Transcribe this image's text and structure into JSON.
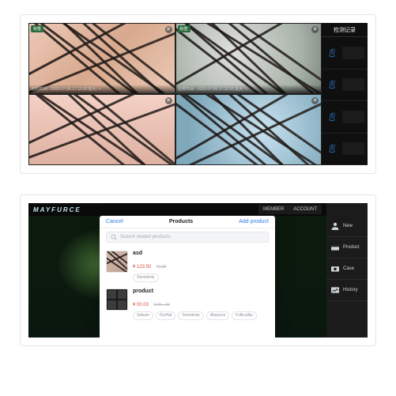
{
  "shot1": {
    "tiles": [
      {
        "badge": "标签",
        "meta": "拍照时间 : 2020-07-06 17:11:20 放大: ×"
      },
      {
        "badge": "标签",
        "meta": "拍照时间 : 2020-07-06 17:11:20 放大: ×"
      },
      {
        "badge": "",
        "meta": ""
      },
      {
        "badge": "",
        "meta": ""
      }
    ],
    "side_title": "检测记录"
  },
  "shot2": {
    "logo": "MAYFURCE",
    "top_tabs": [
      "MEMBER",
      "ACCOUNT"
    ],
    "nav": [
      {
        "label": "New"
      },
      {
        "label": "Product"
      },
      {
        "label": "Case"
      },
      {
        "label": "History"
      }
    ],
    "modal": {
      "cancel": "Cancel",
      "title": "Products",
      "add": "Add product",
      "search_placeholder": "Search related products",
      "items": [
        {
          "name": "asd",
          "price": "¥ 123.50",
          "strike": "¥1.00",
          "tags": [
            "Sensitivity"
          ]
        },
        {
          "name": "product",
          "price": "¥ 00.03",
          "strike": "0.00→03",
          "tags": [
            "Sebum",
            "DryHat",
            "Sensitivity",
            "Alopecia",
            "Folliculitis"
          ]
        }
      ]
    }
  }
}
